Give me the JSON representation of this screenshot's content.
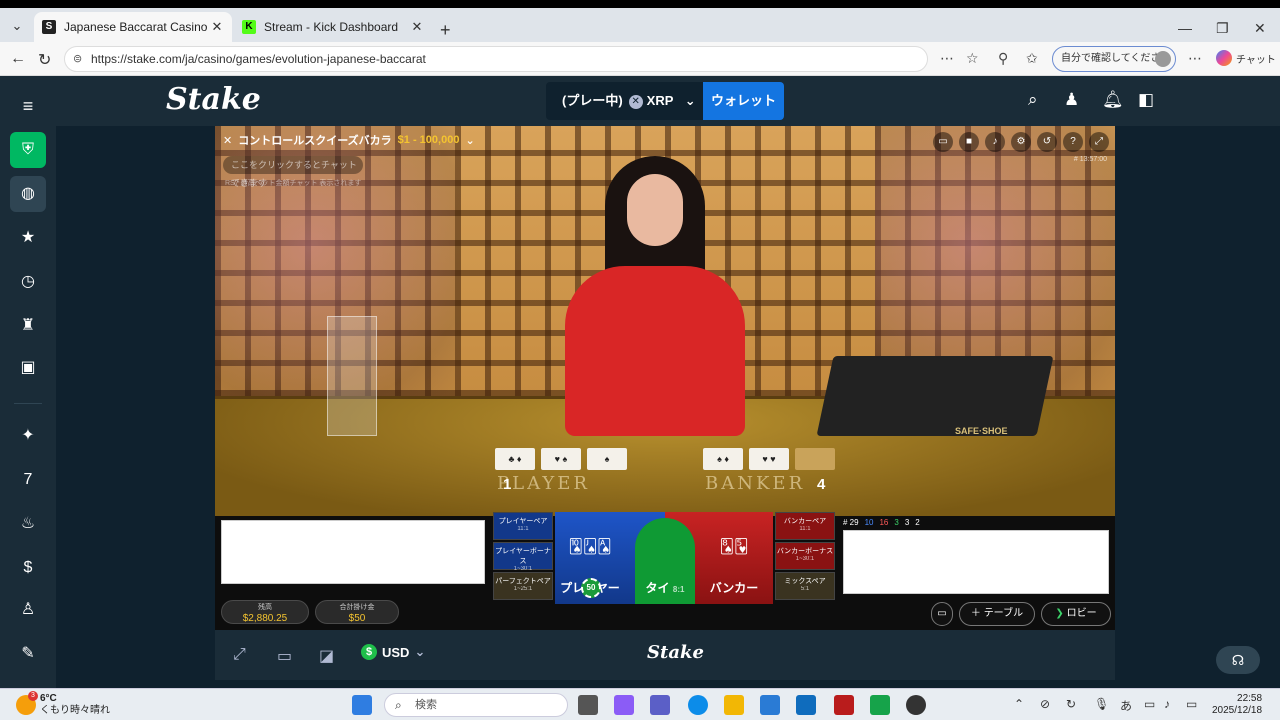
{
  "browser": {
    "tabs": [
      {
        "title": "Japanese Baccarat Casino Game b",
        "favicon": "stake-s-icon",
        "active": true
      },
      {
        "title": "Stream - Kick Dashboard",
        "favicon": "kick-k-icon",
        "active": false
      }
    ],
    "url": "https://stake.com/ja/casino/games/evolution-japanese-baccarat",
    "profile_label": "自分で確認してください",
    "chat_label": "チャット"
  },
  "stake": {
    "logo": "Stake",
    "play_state": "(プレー中)",
    "currency_code": "XRP",
    "wallet_button": "ウォレット",
    "footer_currency": "USD",
    "footer_logo": "Stake"
  },
  "game": {
    "title": "コントロールスクイーズバカラ",
    "limits": "$1 - 100,000",
    "chat_placeholder": "ここをクリックするとチャットできます",
    "chat_sub": "RS7 最高ベット金額チャット 表示されます",
    "time": "# 13:57:00",
    "player_label": "PLAYER",
    "banker_label": "BANKER",
    "player_score": "1",
    "banker_score": "4",
    "stats": {
      "hand": "# 29",
      "p": "10",
      "b": "16",
      "t": "3",
      "pp": "3",
      "bp": "2"
    },
    "bets": {
      "player_pair": "プレイヤーペア",
      "player_pair_odds": "11:1",
      "player_bonus": "プレイヤーボーナス",
      "player_bonus_odds": "1~30:1",
      "perfect_pair": "パーフェクトペア",
      "perfect_pair_odds": "1~25:1",
      "player": "プレイヤー",
      "tie": "タイ",
      "tie_odds": "8:1",
      "banker": "バンカー",
      "banker_pair": "バンカーペア",
      "banker_pair_odds": "11:1",
      "banker_bonus": "バンカーボーナス",
      "banker_bonus_odds": "1~30:1",
      "mix_pair": "ミックスペア",
      "mix_pair_odds": "5:1",
      "chip": "50"
    },
    "balance_label": "残高",
    "balance": "$2,880.25",
    "total_bet_label": "合計掛け金",
    "total_bet": "$50",
    "table_btn": "テーブル",
    "lobby_btn": "ロビー"
  },
  "taskbar": {
    "temp": "6°C",
    "weather": "くもり時々晴れ",
    "weather_badge": "3",
    "search_placeholder": "検索",
    "ime": "あ",
    "time": "22:58",
    "date": "2025/12/18"
  },
  "colors": {
    "stake_bg": "#0f212e",
    "stake_panel": "#1a2c38",
    "accent_blue": "#1475e1",
    "accent_green": "#00b862"
  }
}
